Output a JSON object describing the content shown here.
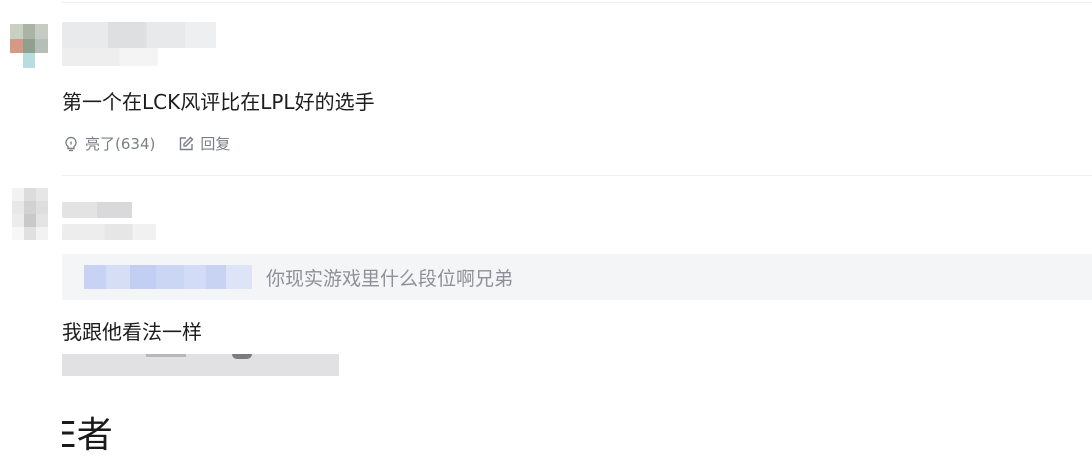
{
  "comments": [
    {
      "text": "第一个在LCK风评比在LPL好的选手",
      "actions": {
        "like_label": "亮了(634)",
        "like_icon": "lightbulb-icon",
        "reply_label": "回复",
        "reply_icon": "edit-icon"
      }
    },
    {
      "quote": {
        "text": "你现实游戏里什么段位啊兄弟"
      },
      "text": "我跟他看法一样",
      "image_caption_fragment": "E者"
    }
  ],
  "colors": {
    "action_gray": "#7a7f87",
    "quote_bg": "#f4f5f7",
    "quote_text": "#8c9199",
    "quote_user_blue": "#c6d3f3"
  }
}
